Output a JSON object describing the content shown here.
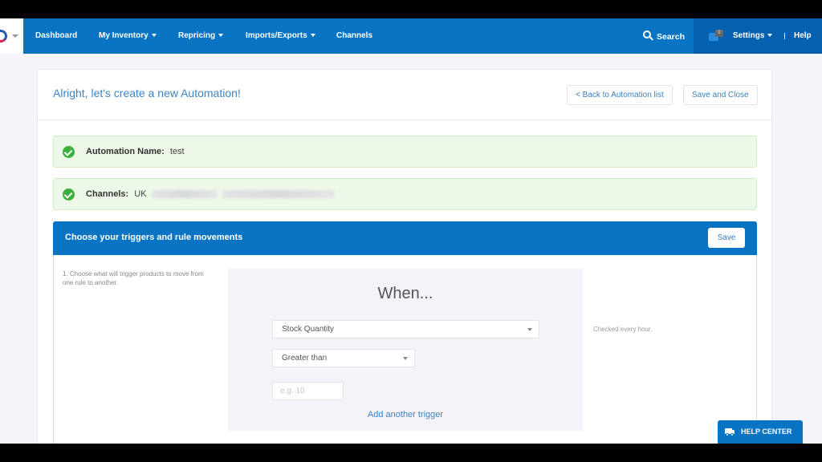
{
  "navbar": {
    "items": [
      {
        "label": "Dashboard",
        "has_dropdown": false
      },
      {
        "label": "My Inventory",
        "has_dropdown": true
      },
      {
        "label": "Repricing",
        "has_dropdown": true
      },
      {
        "label": "Imports/Exports",
        "has_dropdown": true
      },
      {
        "label": "Channels",
        "has_dropdown": false
      }
    ],
    "search_label": "Search",
    "notification_count": "0",
    "settings_label": "Settings",
    "help_label": "Help",
    "colors": {
      "primary": "#0a74c4",
      "right_section": "#0660b0"
    }
  },
  "page": {
    "title": "Alright, let's create a new Automation!",
    "back_button": "< Back to Automation list",
    "save_close_button": "Save and Close"
  },
  "summary": {
    "automation_name_label": "Automation Name:",
    "automation_name_value": "test",
    "channels_label": "Channels:",
    "channels_value": "UK",
    "success_color": "#3cb03c"
  },
  "triggers": {
    "header_title": "Choose your triggers and rule movements",
    "save_button": "Save",
    "step_text": "1. Choose what will trigger products to move from one rule to another.",
    "when_title": "When...",
    "metric_select": {
      "selected": "Stock Quantity"
    },
    "operator_select": {
      "selected": "Greater than"
    },
    "value_input": {
      "value": "",
      "placeholder": "e.g. 10"
    },
    "add_trigger_link": "Add another trigger",
    "checked_note": "Checked every hour."
  },
  "help_center": {
    "label": "HELP CENTER"
  }
}
